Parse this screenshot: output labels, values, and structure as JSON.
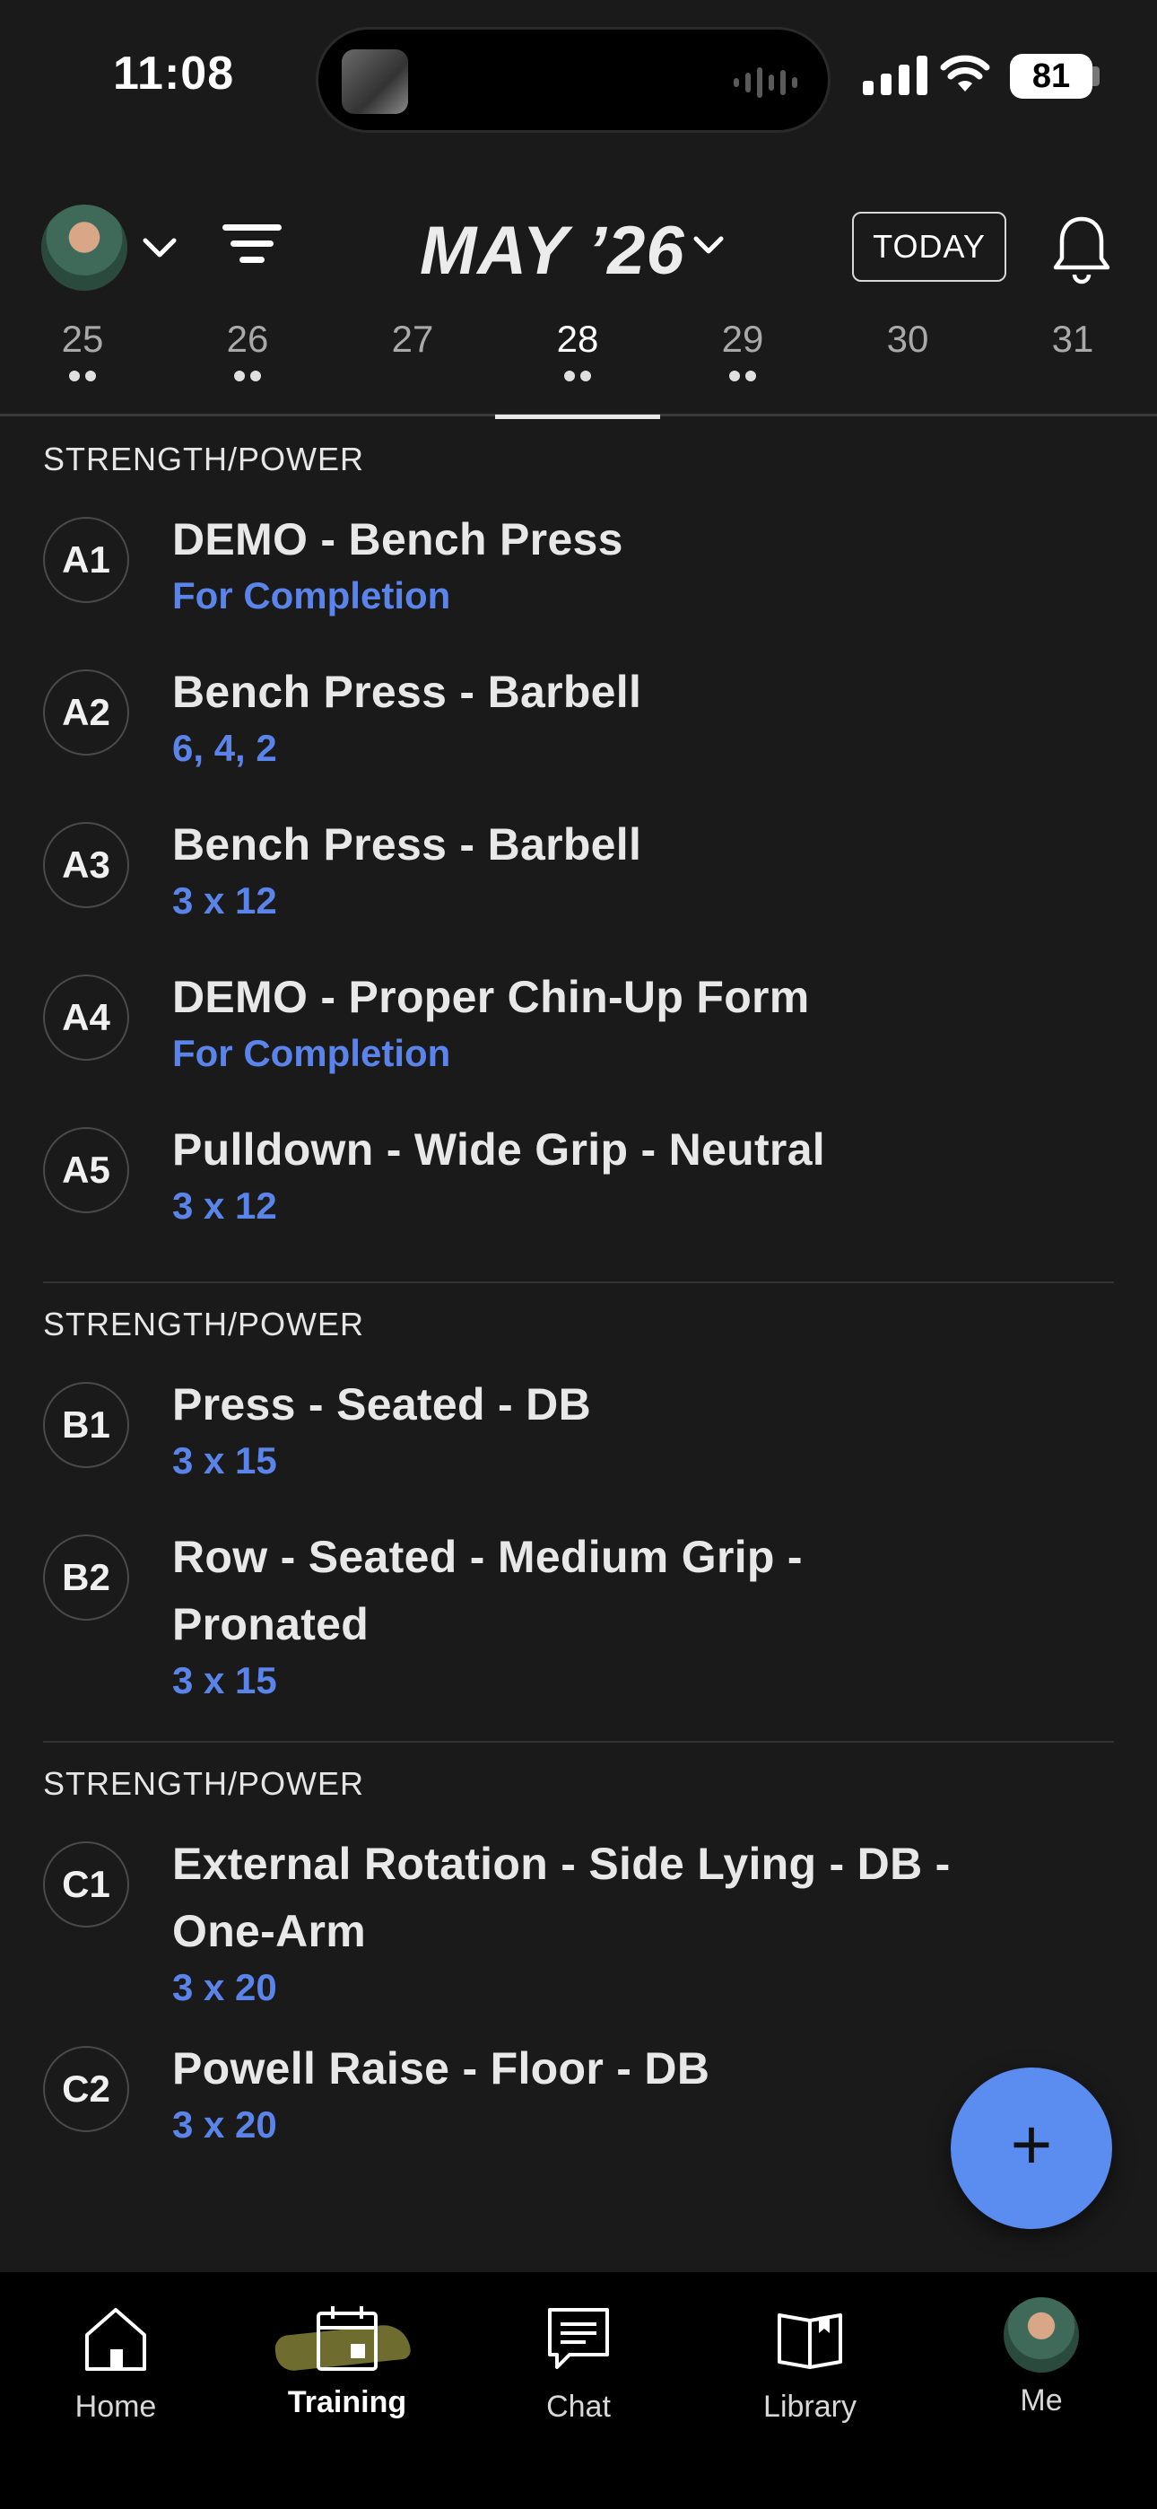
{
  "status_bar": {
    "time": "11:08",
    "battery": "81"
  },
  "header": {
    "month": "MAY ’26",
    "today_label": "TODAY"
  },
  "dates": [
    {
      "day": "25",
      "dots": 2,
      "selected": false
    },
    {
      "day": "26",
      "dots": 2,
      "selected": false
    },
    {
      "day": "27",
      "dots": 0,
      "selected": false
    },
    {
      "day": "28",
      "dots": 2,
      "selected": true
    },
    {
      "day": "29",
      "dots": 2,
      "selected": false
    },
    {
      "day": "30",
      "dots": 0,
      "selected": false
    },
    {
      "day": "31",
      "dots": 0,
      "selected": false
    }
  ],
  "sections": [
    {
      "label": "STRENGTH/POWER",
      "exercises": [
        {
          "code": "A1",
          "name": "DEMO - Bench Press",
          "detail": "For Completion"
        },
        {
          "code": "A2",
          "name": "Bench Press - Barbell",
          "detail": "6, 4, 2"
        },
        {
          "code": "A3",
          "name": "Bench Press - Barbell",
          "detail": "3 x 12"
        },
        {
          "code": "A4",
          "name": "DEMO - Proper Chin-Up Form",
          "detail": "For Completion"
        },
        {
          "code": "A5",
          "name": "Pulldown - Wide Grip - Neutral",
          "detail": "3 x 12"
        }
      ]
    },
    {
      "label": "STRENGTH/POWER",
      "exercises": [
        {
          "code": "B1",
          "name": "Press - Seated - DB",
          "detail": "3 x 15"
        },
        {
          "code": "B2",
          "name": "Row - Seated - Medium Grip - Pronated",
          "detail": "3 x 15"
        }
      ]
    },
    {
      "label": "STRENGTH/POWER",
      "exercises": [
        {
          "code": "C1",
          "name": "External Rotation - Side Lying - DB - One-Arm",
          "detail": "3 x 20"
        },
        {
          "code": "C2",
          "name": "Powell Raise - Floor - DB",
          "detail": "3 x 20"
        }
      ]
    }
  ],
  "fab": {
    "label": "+"
  },
  "tabs": [
    {
      "label": "Home",
      "icon": "home-icon",
      "active": false
    },
    {
      "label": "Training",
      "icon": "calendar-icon",
      "active": true
    },
    {
      "label": "Chat",
      "icon": "chat-icon",
      "active": false
    },
    {
      "label": "Library",
      "icon": "book-icon",
      "active": false
    },
    {
      "label": "Me",
      "icon": "avatar",
      "active": false
    }
  ],
  "colors": {
    "background": "#1a1a1a",
    "accent": "#5b84ea",
    "fab": "#5b8cf0"
  }
}
